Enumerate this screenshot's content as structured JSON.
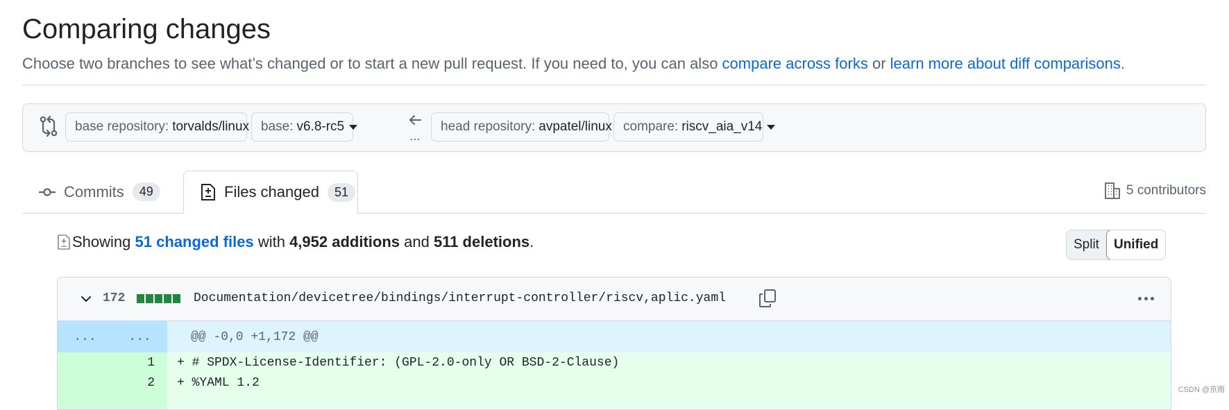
{
  "header": {
    "title": "Comparing changes",
    "subtitle_prefix": "Choose two branches to see what’s changed or to start a new pull request. If you need to, you can also ",
    "link_forks": "compare across forks",
    "subtitle_or": " or ",
    "link_learn": "learn more about diff comparisons",
    "subtitle_suffix": "."
  },
  "range": {
    "base_repo_label": "base repository:",
    "base_repo_value": "torvalds/linux",
    "base_label": "base:",
    "base_value": "v6.8-rc5",
    "head_repo_label": "head repository:",
    "head_repo_value": "avpatel/linux",
    "compare_label": "compare:",
    "compare_value": "riscv_aia_v14",
    "swap_ellipsis": "..."
  },
  "tabs": {
    "commits_label": "Commits",
    "commits_count": "49",
    "files_label": "Files changed",
    "files_count": "51",
    "contributors": "5 contributors"
  },
  "summary": {
    "showing": "Showing",
    "changed_files": "51 changed files",
    "with": " with ",
    "additions": "4,952 additions",
    "and": " and ",
    "deletions": "511 deletions",
    "period": "."
  },
  "view_toggle": {
    "split": "Split",
    "unified": "Unified"
  },
  "file": {
    "change_count": "172",
    "path": "Documentation/devicetree/bindings/interrupt-controller/riscv,aplic.yaml",
    "hunk_left": "...",
    "hunk_right": "...",
    "hunk_header": "@@ -0,0 +1,172 @@",
    "lines": [
      {
        "num": "1",
        "text": "+ # SPDX-License-Identifier: (GPL-2.0-only OR BSD-2-Clause)"
      },
      {
        "num": "2",
        "text": "+ %YAML 1.2"
      }
    ]
  },
  "watermark": "CSDN @京雨",
  "colors": {
    "link": "#0969da",
    "addition": "#1f883d",
    "hunk_bg": "#ddf4ff",
    "add_bg": "#e6ffec"
  }
}
